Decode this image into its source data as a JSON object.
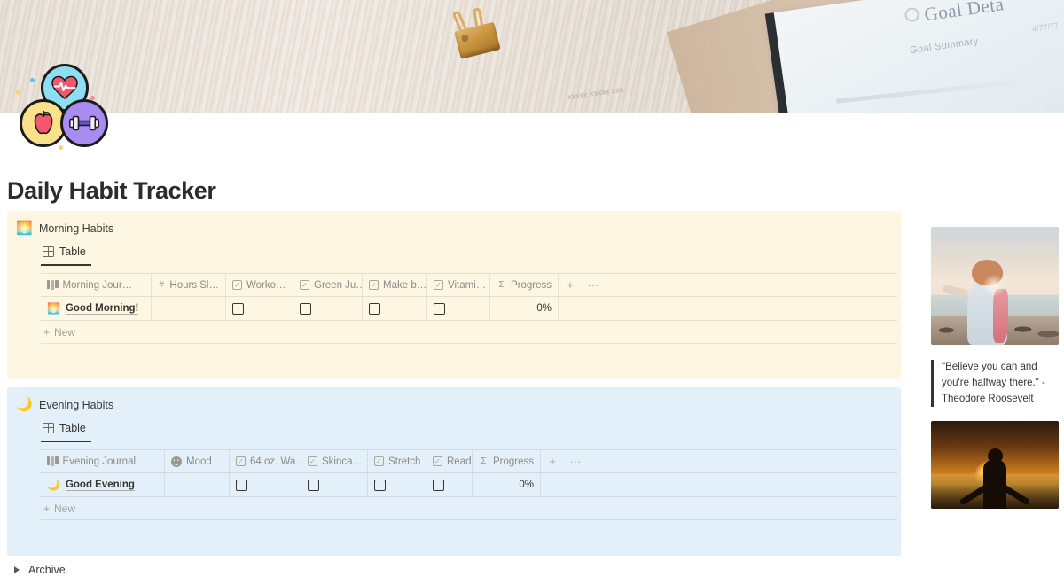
{
  "banner": {
    "planner_title": "Goal Deta",
    "planner_sub": "Goal Summary",
    "planner_sub2": "4/77/77",
    "smudge": "xxxxx xxxxx xxx"
  },
  "icons": {
    "heart": "heart-pulse-icon",
    "apple": "apple-icon",
    "dumbbell": "dumbbell-icon"
  },
  "page": {
    "title": "Daily Habit Tracker"
  },
  "morning": {
    "emoji": "🌅",
    "title": "Morning Habits",
    "tab": "Table",
    "new_label": "New",
    "add_column": "+",
    "more": "···",
    "columns": [
      {
        "icon": "text-icon",
        "label": "Morning Jour…",
        "type": "title"
      },
      {
        "icon": "number-icon",
        "label": "Hours Sl…",
        "type": "number"
      },
      {
        "icon": "checkbox-icon",
        "label": "Worko…",
        "type": "checkbox"
      },
      {
        "icon": "checkbox-icon",
        "label": "Green Ju…",
        "type": "checkbox"
      },
      {
        "icon": "checkbox-icon",
        "label": "Make b…",
        "type": "checkbox"
      },
      {
        "icon": "checkbox-icon",
        "label": "Vitami…",
        "type": "checkbox"
      },
      {
        "icon": "sigma-icon",
        "label": "Progress",
        "type": "formula"
      }
    ],
    "rows": [
      {
        "emoji": "🌅",
        "label": "Good Morning!",
        "hours": "",
        "workout": false,
        "green_juice": false,
        "make_bed": false,
        "vitamins": false,
        "progress": "0%"
      }
    ]
  },
  "evening": {
    "emoji": "🌙",
    "title": "Evening Habits",
    "tab": "Table",
    "new_label": "New",
    "add_column": "+",
    "more": "···",
    "columns": [
      {
        "icon": "text-icon",
        "label": "Evening Journal",
        "type": "title"
      },
      {
        "icon": "select-icon",
        "label": "Mood",
        "type": "select"
      },
      {
        "icon": "checkbox-icon",
        "label": "64 oz. Wa…",
        "type": "checkbox"
      },
      {
        "icon": "checkbox-icon",
        "label": "Skinca…",
        "type": "checkbox"
      },
      {
        "icon": "checkbox-icon",
        "label": "Stretch",
        "type": "checkbox"
      },
      {
        "icon": "checkbox-icon",
        "label": "Read",
        "type": "checkbox"
      },
      {
        "icon": "sigma-icon",
        "label": "Progress",
        "type": "formula"
      }
    ],
    "rows": [
      {
        "emoji": "🌙",
        "label": "Good Evening",
        "mood": "",
        "water": false,
        "skincare": false,
        "stretch": false,
        "read": false,
        "progress": "0%"
      }
    ]
  },
  "sidebar": {
    "image_one_alt": "woman-at-beach-sunset",
    "image_two_alt": "silhouette-arms-raised-sunset",
    "quote": "\"Believe you can and you're halfway there.\" - Theodore Roosevelt"
  },
  "archive": {
    "label": "Archive"
  },
  "colors": {
    "morning_bg": "#FDF6E3",
    "evening_bg": "#E4F0F9",
    "text": "#37352F",
    "muted": "#8C8A84"
  }
}
